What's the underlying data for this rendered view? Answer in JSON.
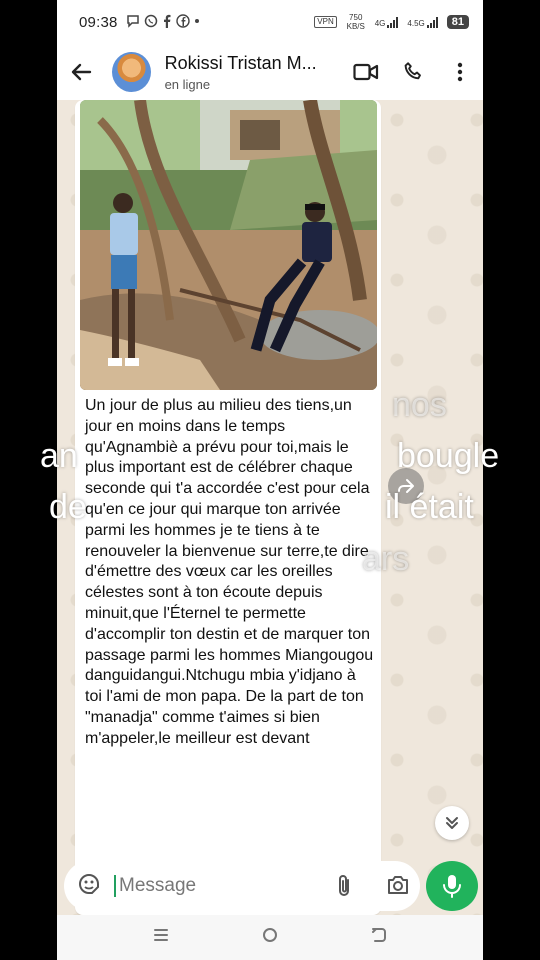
{
  "status_bar": {
    "time": "09:38",
    "notification_icons": [
      "chat-bubble-icon",
      "whatsapp-icon",
      "facebook-icon",
      "facebook-icon",
      "dot-icon"
    ],
    "vpn": "VPN",
    "speed": "750 KB/S",
    "signal1": "4G",
    "signal2": "4.5G",
    "battery": "81"
  },
  "header": {
    "contact_name": "Rokissi Tristan M...",
    "contact_status": "en ligne"
  },
  "message": {
    "text": "Un jour de plus au milieu des tiens,un jour en moins dans le temps qu'Agnambiè a prévu pour toi,mais le plus important est de célébrer chaque seconde qui t'a accordée c'est pour cela qu'en ce jour qui marque ton arrivée parmi les hommes je te tiens à te renouveler la bienvenue sur terre,te dire d'émettre des vœux car les oreilles célestes sont à ton écoute depuis minuit,que l'Éternel te permette d'accomplir ton destin et de marquer ton passage parmi les hommes Miangougou danguidangui.Ntchugu mbia y'idjano à toi l'ami de mon papa. De la part de ton \"manadja\" comme t'aimes si bien m'appeler,le meilleur est devant"
  },
  "overlay_caption": {
    "line1": "nos",
    "line2_left": "an",
    "line2_right": "bougle",
    "line3_left": "de",
    "line3_right": "il était",
    "line4": "ars"
  },
  "input": {
    "placeholder": "Message"
  },
  "colors": {
    "accent_green": "#21b35c",
    "wallpaper": "#efe7dc"
  }
}
